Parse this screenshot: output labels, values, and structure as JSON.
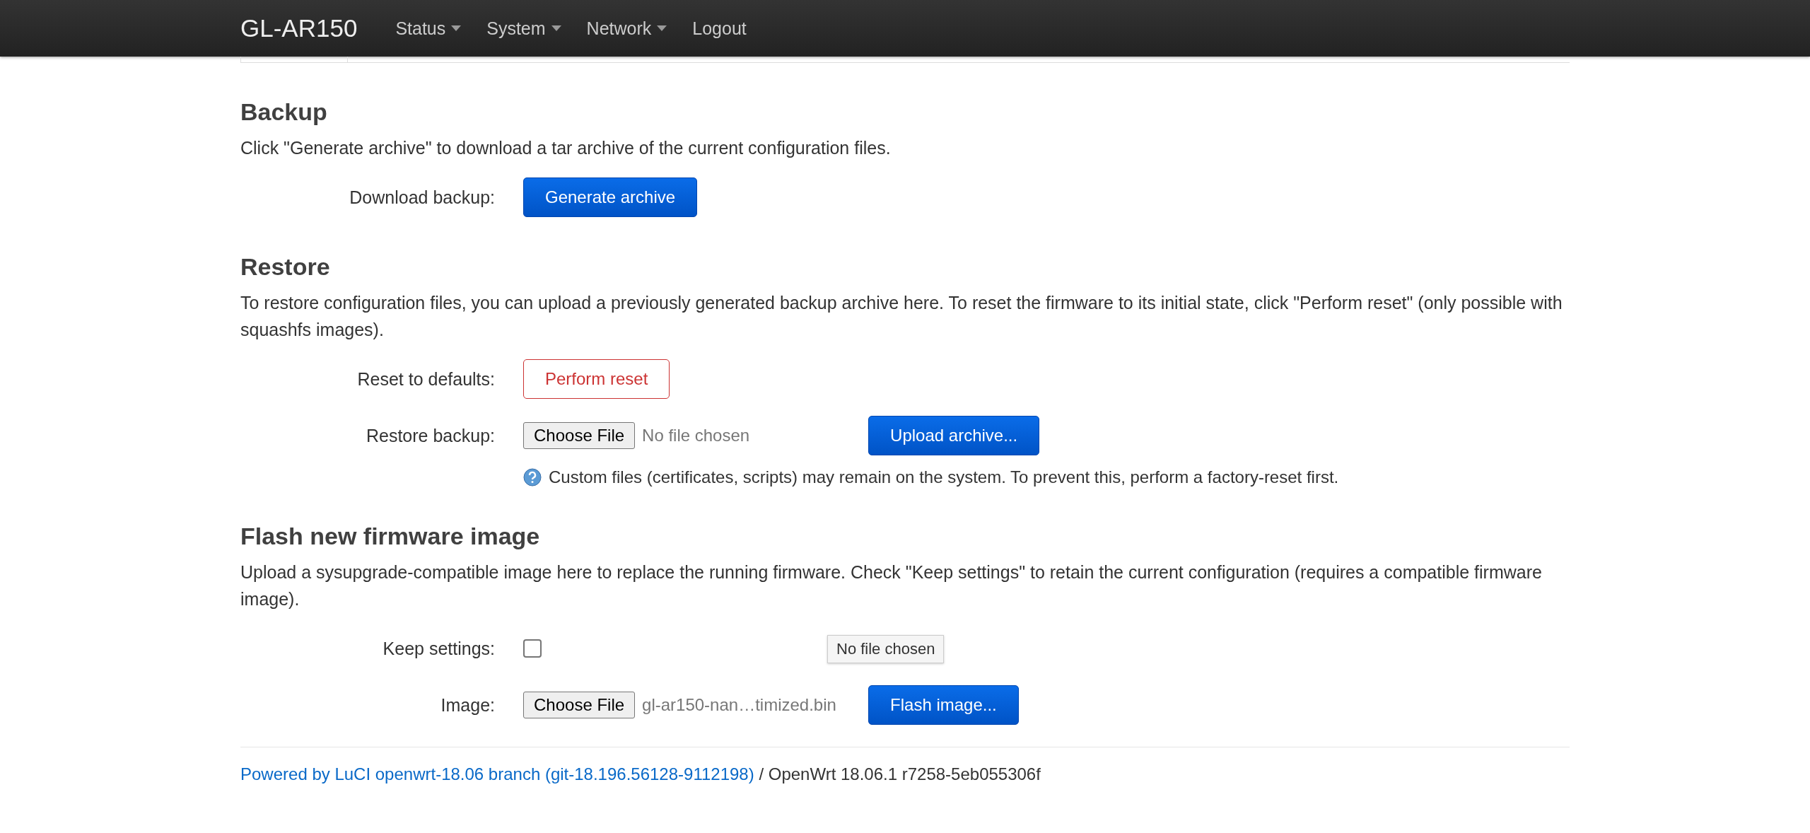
{
  "navbar": {
    "brand": "GL-AR150",
    "menus": [
      {
        "label": "Status",
        "dropdown": true
      },
      {
        "label": "System",
        "dropdown": true
      },
      {
        "label": "Network",
        "dropdown": true
      },
      {
        "label": "Logout",
        "dropdown": false
      }
    ]
  },
  "sections": [
    {
      "title": "Backup",
      "description": "Click \"Generate archive\" to download a tar archive of the current configuration files.",
      "rows": [
        {
          "kind": "button",
          "label": "Download backup:",
          "button": {
            "text": "Generate archive"
          }
        }
      ]
    },
    {
      "title": "Restore",
      "description": "To restore configuration files, you can upload a previously generated backup archive here. To reset the firmware to its initial state, click \"Perform reset\" (only possible with squashfs images).",
      "rows": [
        {
          "kind": "reset",
          "label": "Reset to defaults:",
          "button": {
            "text": "Perform reset"
          }
        },
        {
          "kind": "file",
          "label": "Restore backup:",
          "choose": "Choose File",
          "file_name": "No file chosen",
          "action": "Upload archive...",
          "note": "Custom files (certificates, scripts) may remain on the system. To prevent this, perform a factory-reset first."
        }
      ]
    },
    {
      "title": "Flash new firmware image",
      "description": "Upload a sysupgrade-compatible image here to replace the running firmware. Check \"Keep settings\" to retain the current configuration (requires a compatible firmware image).",
      "rows": [
        {
          "kind": "checkbox",
          "label": "Keep settings:",
          "checked": false,
          "tooltip": "No file chosen"
        },
        {
          "kind": "file",
          "label": "Image:",
          "choose": "Choose File",
          "file_name": "gl-ar150-nan…timized.bin",
          "action": "Flash image..."
        }
      ]
    }
  ],
  "footer": {
    "link": "Powered by LuCI openwrt-18.06 branch (git-18.196.56128-9112198)",
    "text": "/ OpenWrt 18.06.1 r7258-5eb055306f"
  }
}
